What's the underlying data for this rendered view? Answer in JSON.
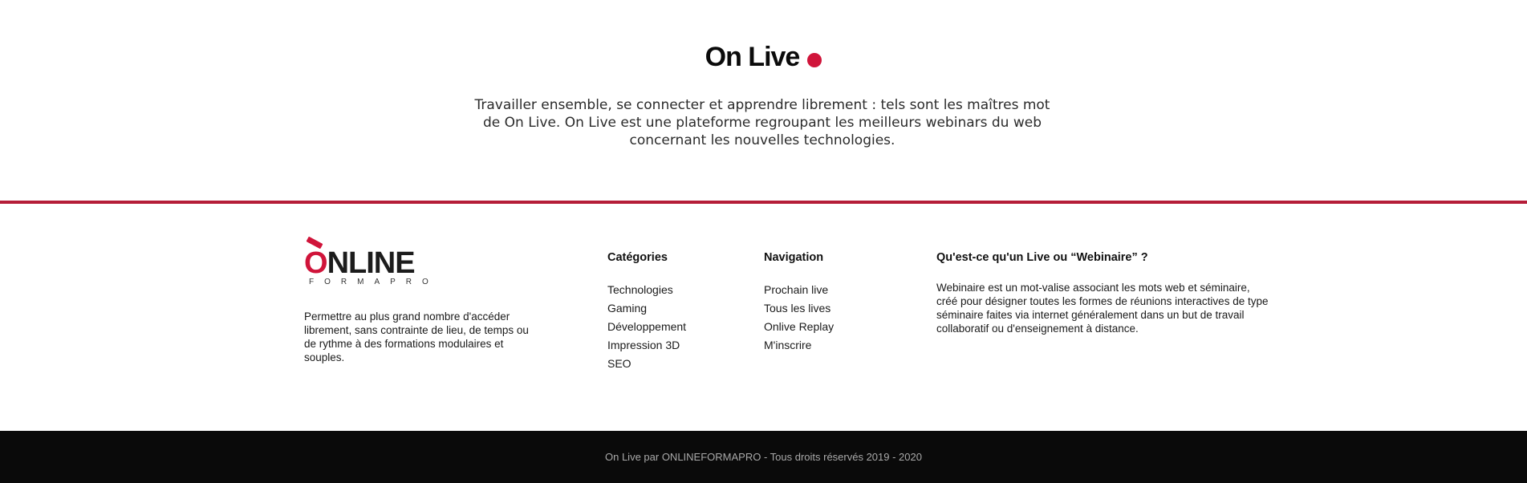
{
  "hero": {
    "title": "On Live",
    "description": "Travailler ensemble, se connecter et apprendre librement : tels sont les maîtres mot de On Live. On Live est une plateforme regroupant les meilleurs webinars du web concernant les nouvelles technologies."
  },
  "footer": {
    "logo": {
      "word": "NLINE",
      "letter_o": "O",
      "subtitle": "FORMAPRO"
    },
    "about": "Permettre au plus grand nombre d'accéder librement, sans contrainte de lieu, de temps ou de rythme à des formations modulaires et souples.",
    "categories": {
      "title": "Catégories",
      "items": [
        "Technologies",
        "Gaming",
        "Développement",
        "Impression 3D",
        "SEO"
      ]
    },
    "navigation": {
      "title": "Navigation",
      "items": [
        "Prochain live",
        "Tous les lives",
        "Onlive Replay",
        "M'inscrire"
      ]
    },
    "info": {
      "title": "Qu'est-ce qu'un Live ou “Webinaire” ?",
      "text": "Webinaire est un mot-valise associant les mots web et séminaire, créé pour désigner toutes les formes de réunions interactives de type séminaire faites via internet généralement dans un but de travail collaboratif ou d'enseignement à distance."
    }
  },
  "bottom": {
    "copyright": "On Live par ONLINEFORMAPRO - Tous droits réservés 2019 - 2020"
  },
  "colors": {
    "accent": "#d0143a",
    "divider": "#b51d38",
    "bottom_bar": "#0a0a0a"
  }
}
